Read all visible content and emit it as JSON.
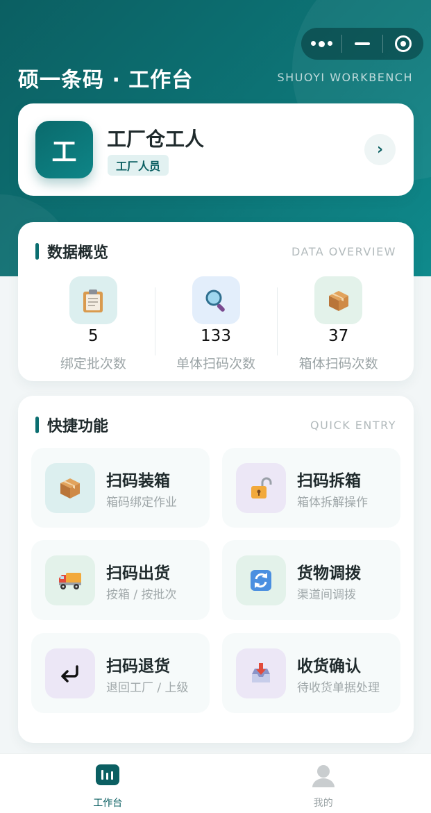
{
  "header": {
    "title": "硕一条码 · 工作台",
    "subtitle": "SHUOYI WORKBENCH"
  },
  "profile": {
    "avatar_initial": "工",
    "name": "工厂仓工人",
    "role": "工厂人员",
    "arrow": "›"
  },
  "overview": {
    "title": "数据概览",
    "title_en": "DATA OVERVIEW",
    "stats": [
      {
        "value": "5",
        "label": "绑定批次数",
        "icon": "clipboard-icon"
      },
      {
        "value": "133",
        "label": "单体扫码次数",
        "icon": "magnifier-icon"
      },
      {
        "value": "37",
        "label": "箱体扫码次数",
        "icon": "package-icon"
      }
    ]
  },
  "quick": {
    "title": "快捷功能",
    "title_en": "QUICK ENTRY",
    "items": [
      {
        "title": "扫码装箱",
        "sub": "箱码绑定作业",
        "icon": "package-icon"
      },
      {
        "title": "扫码拆箱",
        "sub": "箱体拆解操作",
        "icon": "unlock-icon"
      },
      {
        "title": "扫码出货",
        "sub": "按箱 / 按批次",
        "icon": "truck-icon"
      },
      {
        "title": "货物调拨",
        "sub": "渠道间调拨",
        "icon": "refresh-icon"
      },
      {
        "title": "扫码退货",
        "sub": "退回工厂 / 上级",
        "icon": "return-arrow-icon"
      },
      {
        "title": "收货确认",
        "sub": "待收货单据处理",
        "icon": "inbox-icon"
      }
    ]
  },
  "tabbar": {
    "items": [
      {
        "label": "工作台",
        "icon": "workbench-chart-icon",
        "active": true
      },
      {
        "label": "我的",
        "icon": "user-icon",
        "active": false
      }
    ]
  },
  "colors": {
    "primary": "#0b6e70",
    "primary_dark": "#0b5f62",
    "muted_text": "#9aa3a5"
  }
}
